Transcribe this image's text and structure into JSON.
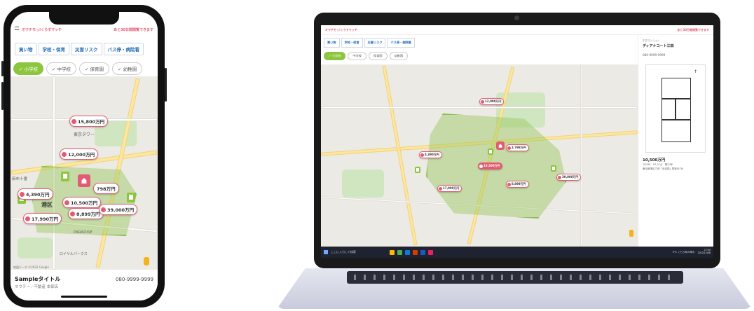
{
  "app": {
    "logo": "オウチモっ!くらすマッチ",
    "notice": "あと30日間閲覧できます"
  },
  "tabs": [
    {
      "label": "買い物"
    },
    {
      "label": "学校・保育"
    },
    {
      "label": "災害リスク"
    },
    {
      "label": "バス停・病院看"
    }
  ],
  "filters": [
    {
      "label": "小学校",
      "active": true
    },
    {
      "label": "中学校",
      "active": false
    },
    {
      "label": "保育園",
      "active": false
    },
    {
      "label": "幼稚園",
      "active": false
    }
  ],
  "phone_map": {
    "ward_label": "港区",
    "labels": [
      "東京タワー",
      "麻布十番",
      "PARADISE",
      "ロイヤルパークス"
    ],
    "credit": "地図データ ©2022 Google",
    "pins": [
      {
        "price": "15,800万円",
        "selected": false
      },
      {
        "price": "12,000万円",
        "selected": false
      },
      {
        "price": "4,390万円",
        "selected": false
      },
      {
        "price": "10,500万円",
        "selected": true
      },
      {
        "price": "798万円",
        "selected": false
      },
      {
        "price": "8,899万円",
        "selected": false
      },
      {
        "price": "39,000万円",
        "selected": false
      },
      {
        "price": "17,990万円",
        "selected": false
      }
    ]
  },
  "listing": {
    "title": "Sampleタイトル",
    "agent": "オウチー／不動産 本部店",
    "phone": "080-9999-9999"
  },
  "laptop_map": {
    "pins": [
      {
        "price": "12,000万円",
        "selected": false
      },
      {
        "price": "2,798万円",
        "selected": false
      },
      {
        "price": "4,390万円",
        "selected": false
      },
      {
        "price": "10,500万円",
        "selected": true
      },
      {
        "price": "39,000万円",
        "selected": false
      },
      {
        "price": "8,899万円",
        "selected": false
      },
      {
        "price": "17,990万円",
        "selected": false
      }
    ]
  },
  "detail_panel": {
    "type": "中古マンション",
    "name": "ディアナコート三田",
    "phone": "080-9999-9999",
    "price": "10,500万円",
    "spec": "1SLDK　97.22㎡　築24年",
    "address": "東京都港区三田「赤羽橋」駅徒歩7分"
  },
  "taskbar": {
    "search": "ここに入力して検索",
    "weather": "9°C くもり時々晴れ",
    "time": "17:30",
    "date": "2022/12/08"
  },
  "colors": {
    "accent": "#e25b72",
    "active_filter": "#8cc63f",
    "tab_text": "#1f6bb8"
  }
}
